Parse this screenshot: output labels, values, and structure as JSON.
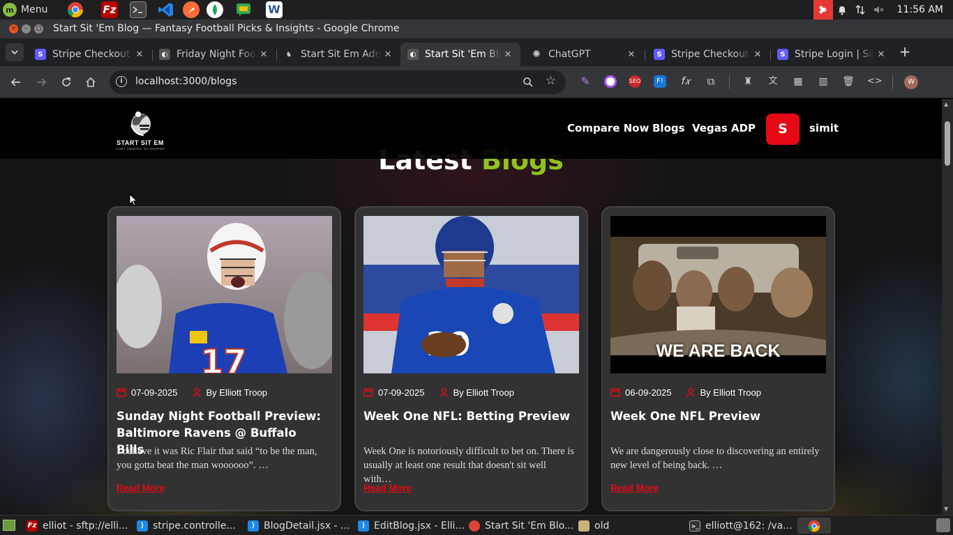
{
  "os": {
    "menu_label": "Menu",
    "clock": "11:56 AM",
    "launchers": [
      "chrome-icon",
      "filezilla-icon",
      "terminal-icon",
      "vscode-icon",
      "postman-icon",
      "mongodb-compass-icon",
      "google-chat-icon",
      "word-icon"
    ]
  },
  "window": {
    "title": "Start Sit 'Em Blog — Fantasy Football Picks & Insights - Google Chrome"
  },
  "tabs": [
    {
      "label": "Stripe Checkout",
      "favicon": "stripe-icon",
      "color": "#635bff",
      "active": false
    },
    {
      "label": "Friday Night Football",
      "favicon": "start-sit-em-icon",
      "color": "#444444",
      "active": false
    },
    {
      "label": "Start Sit Em Admin",
      "favicon": "start-sit-em-icon",
      "color": "#444444",
      "active": false
    },
    {
      "label": "Start Sit 'Em Blog",
      "favicon": "start-sit-em-icon",
      "color": "#444444",
      "active": true
    },
    {
      "label": "ChatGPT",
      "favicon": "chatgpt-icon",
      "color": "#202124",
      "active": false
    },
    {
      "label": "Stripe Checkout",
      "favicon": "stripe-icon",
      "color": "#635bff",
      "active": false
    },
    {
      "label": "Stripe Login | Sign in",
      "favicon": "stripe-icon",
      "color": "#635bff",
      "active": false
    }
  ],
  "omnibox": {
    "url": "localhost:3000/blogs"
  },
  "site": {
    "logo_text": "START SIT EM",
    "logo_sub": "START SMARTER. SIT SHARPER",
    "nav": [
      "Compare Now",
      "Blogs",
      "Vegas ADP"
    ],
    "avatar_letter": "S",
    "username": "simit",
    "section_title_white": "Latest",
    "section_title_green": "Blogs",
    "accent": "#e50914",
    "green": "#8fc21f"
  },
  "blogs": [
    {
      "date": "07-09-2025",
      "author": "By Elliott Troop",
      "title": "Sunday Night Football Preview: Baltimore Ravens @ Buffalo Bills",
      "excerpt": "I believe it was Ric Flair that said “to be the man, you gotta beat the man woooooo”. …",
      "read_more": "Read More",
      "image_caption": ""
    },
    {
      "date": "07-09-2025",
      "author": "By Elliott Troop",
      "title": "Week One NFL: Betting Preview",
      "excerpt": "Week One is notoriously difficult to bet on. There is usually at least one result that doesn't sit well with…",
      "read_more": "Read More",
      "image_caption": ""
    },
    {
      "date": "06-09-2025",
      "author": "By Elliott Troop",
      "title": "Week One NFL Preview",
      "excerpt": "We are dangerously close to discovering an entirely new level of being back. …",
      "read_more": "Read More",
      "image_caption": "WE ARE BACK"
    }
  ],
  "taskbar": [
    {
      "label": "elliot - sftp://elli...",
      "icon": "filezilla-icon"
    },
    {
      "label": "stripe.controlle...",
      "icon": "vscode-icon"
    },
    {
      "label": "BlogDetail.jsx - ...",
      "icon": "vscode-icon"
    },
    {
      "label": "EditBlog.jsx - Elli...",
      "icon": "vscode-icon"
    },
    {
      "label": "Start Sit 'Em Blo...",
      "icon": "chrome-icon"
    },
    {
      "label": "old",
      "icon": "folder-icon"
    },
    {
      "label": "elliott@162: /va...",
      "icon": "terminal-icon"
    }
  ]
}
